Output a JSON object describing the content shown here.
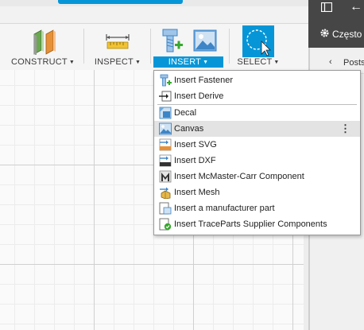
{
  "toolbar": {
    "groups": [
      {
        "label": "CONSTRUCT",
        "active": false
      },
      {
        "label": "INSPECT",
        "active": false
      },
      {
        "label": "INSERT",
        "active": true
      },
      {
        "label": "SELECT",
        "active": false
      }
    ],
    "accent_color": "#0696d7"
  },
  "insert_menu": {
    "items": [
      {
        "label": "Insert Fastener",
        "icon": "fastener-icon"
      },
      {
        "label": "Insert Derive",
        "icon": "derive-icon"
      },
      {
        "label": "Decal",
        "icon": "decal-icon"
      },
      {
        "label": "Canvas",
        "icon": "canvas-icon",
        "hovered": true,
        "more": "⋮"
      },
      {
        "label": "Insert SVG",
        "icon": "svg-icon"
      },
      {
        "label": "Insert DXF",
        "icon": "dxf-icon"
      },
      {
        "label": "Insert McMaster-Carr Component",
        "icon": "mcmaster-icon"
      },
      {
        "label": "Insert Mesh",
        "icon": "mesh-icon"
      },
      {
        "label": "Insert a manufacturer part",
        "icon": "manufacturer-part-icon"
      },
      {
        "label": "Insert TraceParts Supplier Components",
        "icon": "traceparts-icon"
      }
    ]
  },
  "right_panel": {
    "header_label": "Często",
    "list_label": "Posts",
    "nav_back": "<",
    "chevron": "‹"
  }
}
